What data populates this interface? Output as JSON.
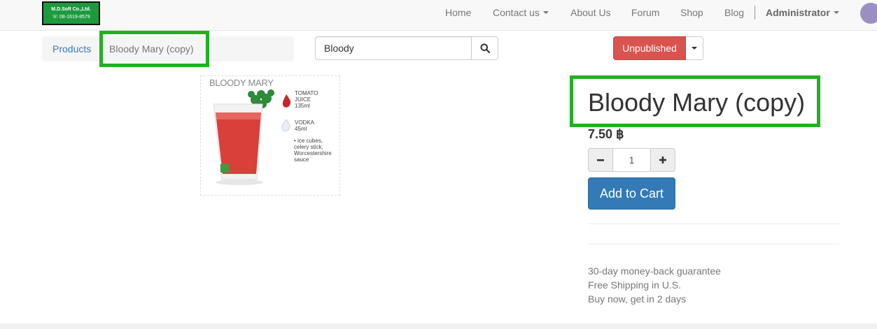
{
  "logo": {
    "line1": "M.D.Soft Co.,Ltd.",
    "line2": "☏ 08-1619-8579"
  },
  "nav": {
    "items": [
      {
        "label": "Home"
      },
      {
        "label": "Contact us"
      },
      {
        "label": "About Us"
      },
      {
        "label": "Forum"
      },
      {
        "label": "Shop"
      },
      {
        "label": "Blog"
      }
    ],
    "user": "Administrator"
  },
  "breadcrumb": {
    "link": "Products",
    "active": "Bloody Mary (copy)"
  },
  "search": {
    "value": "Bloody"
  },
  "publish": {
    "label": "Unpublished",
    "color": "#d9534f"
  },
  "product": {
    "image": {
      "title": "BLOODY MARY",
      "ingredient1": "TOMATO\nJUICE\n135ml",
      "ingredient2": "VODKA\n45ml",
      "extras": "• ice cubes,\ncelery stick,\nWorcestershire\nsauce"
    },
    "name": "Bloody Mary (copy)",
    "price": "7.50 ฿",
    "quantity": "1",
    "add_to_cart": "Add to Cart",
    "info": [
      "30-day money-back guarantee",
      "Free Shipping in U.S.",
      "Buy now, get in 2 days"
    ]
  },
  "colors": {
    "primary": "#337ab7",
    "highlight": "#22b022",
    "danger": "#d9534f"
  }
}
